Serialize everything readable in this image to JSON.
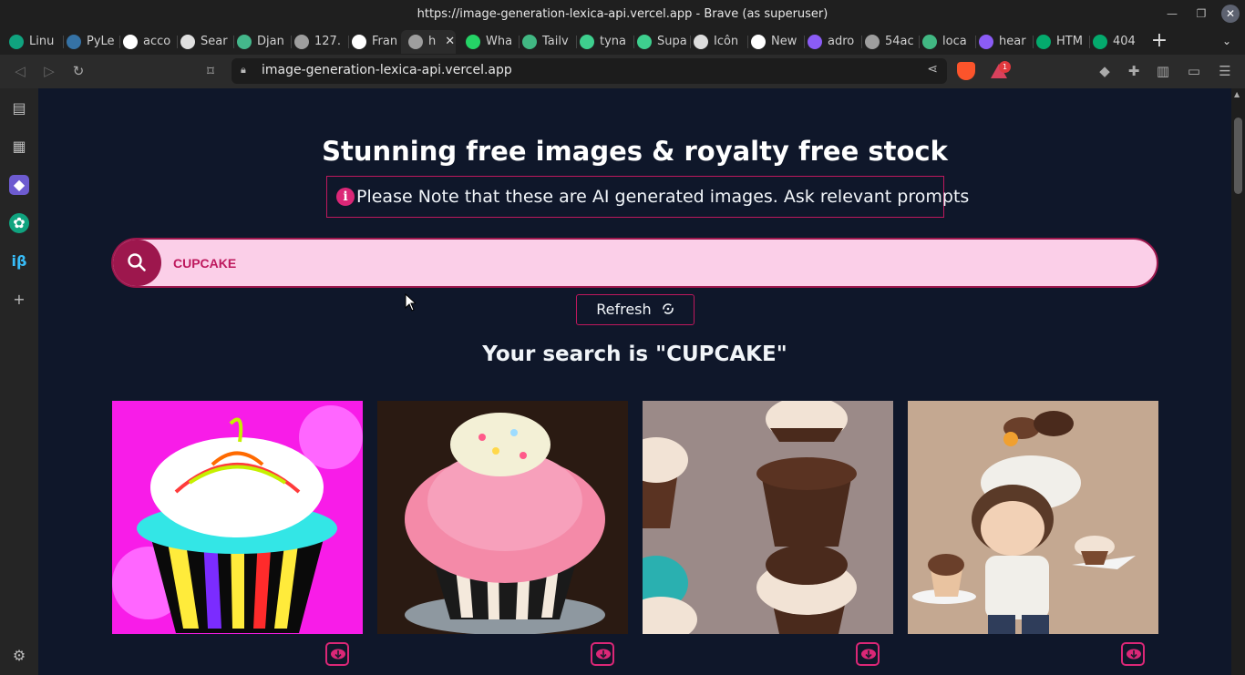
{
  "window": {
    "title": "https://image-generation-lexica-api.vercel.app - Brave (as superuser)"
  },
  "tabs": [
    {
      "label": "Linu",
      "icon": "gpt-icon",
      "color": "#10a37f"
    },
    {
      "label": "PyLe",
      "icon": "python-icon",
      "color": "#3572a5"
    },
    {
      "label": "acco",
      "icon": "google-icon",
      "color": "#ffffff"
    },
    {
      "label": "Sear",
      "icon": "cube-icon",
      "color": "#e0e0e0"
    },
    {
      "label": "Djan",
      "icon": "box-icon",
      "color": "#44b78b"
    },
    {
      "label": "127.",
      "icon": "globe-icon",
      "color": "#9e9e9e"
    },
    {
      "label": "Fran",
      "icon": "github-icon",
      "color": "#ffffff"
    },
    {
      "label": "h",
      "icon": "globe-icon",
      "color": "#9e9e9e"
    },
    {
      "label": "Wha",
      "icon": "whatsapp-icon",
      "color": "#25d366"
    },
    {
      "label": "Tailv",
      "icon": "vue-icon",
      "color": "#41b883"
    },
    {
      "label": "tyna",
      "icon": "chart-icon",
      "color": "#3ecf8e"
    },
    {
      "label": "Supa",
      "icon": "chart-icon",
      "color": "#3ecf8e"
    },
    {
      "label": "Icôn",
      "icon": "o-icon",
      "color": "#dddddd"
    },
    {
      "label": "New",
      "icon": "triangle-icon",
      "color": "#ffffff"
    },
    {
      "label": "adro",
      "icon": "lexica-icon",
      "color": "#8b5cf6"
    },
    {
      "label": "54ac",
      "icon": "globe-icon",
      "color": "#9e9e9e"
    },
    {
      "label": "loca",
      "icon": "vue-icon",
      "color": "#41b883"
    },
    {
      "label": "hear",
      "icon": "lexica-icon",
      "color": "#8b5cf6"
    },
    {
      "label": "HTM",
      "icon": "w3-icon",
      "color": "#04aa6d"
    },
    {
      "label": "404",
      "icon": "w3-icon",
      "color": "#04aa6d"
    }
  ],
  "address_bar": {
    "url": "image-generation-lexica-api.vercel.app"
  },
  "badge_count": "1",
  "page": {
    "headline": "Stunning free images & royalty free stock",
    "notice": "Please Note that these are AI generated images. Ask relevant prompts",
    "search_value": "CUPCAKE",
    "refresh_label": "Refresh",
    "result_heading": "Your search is \"CUPCAKE\""
  },
  "colors": {
    "page_bg": "#0f172a",
    "accent": "#be185d",
    "search_bg": "#fbcfe8"
  }
}
